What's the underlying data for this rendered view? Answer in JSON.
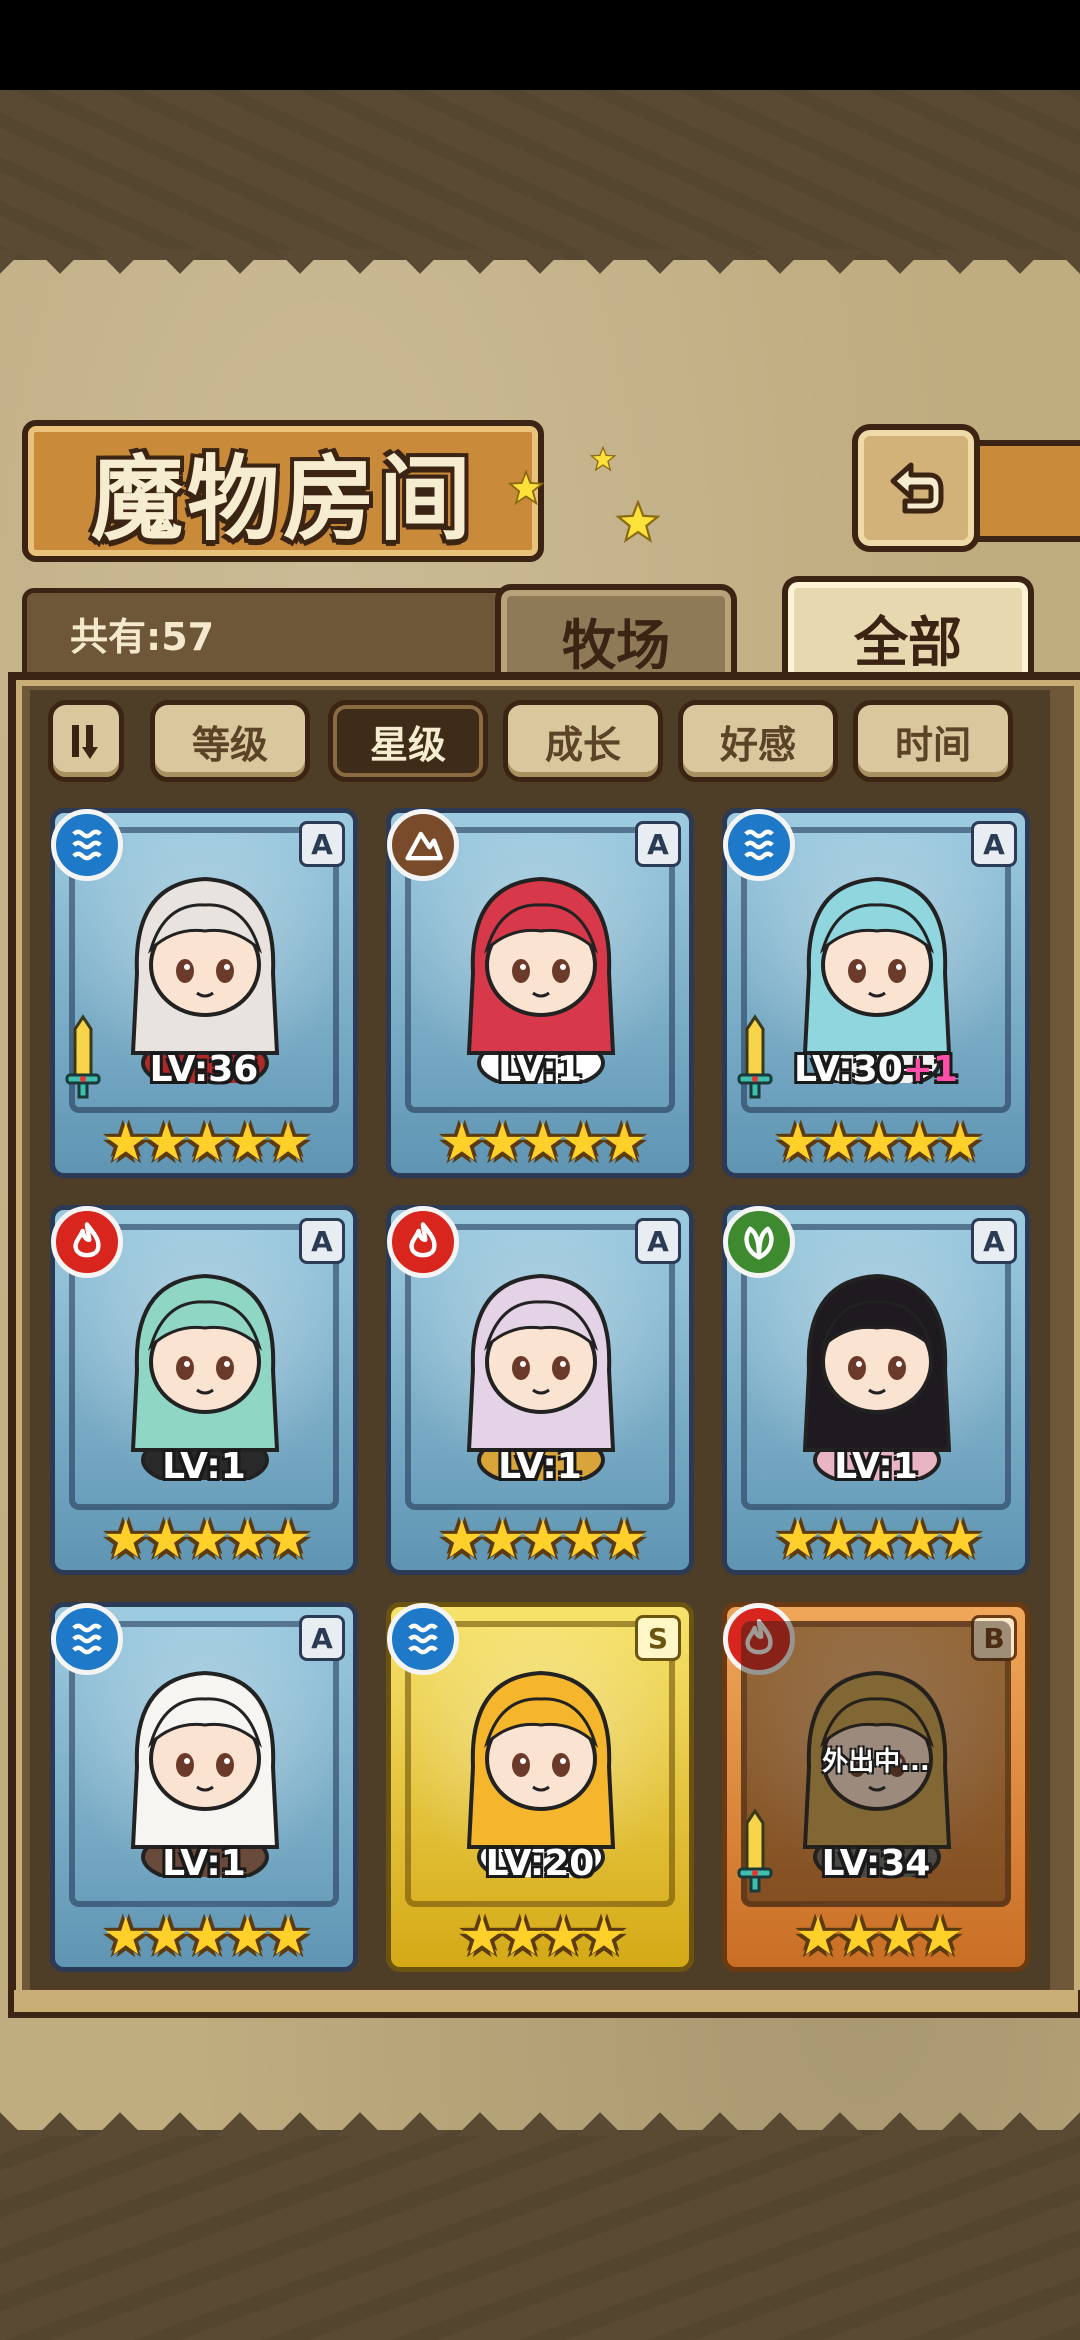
{
  "title": "魔物房间",
  "count_label": "共有:57",
  "tabs": [
    {
      "label": "牧场",
      "active": false
    },
    {
      "label": "全部",
      "active": true
    }
  ],
  "filters": [
    "等级",
    "星级",
    "成长",
    "好感",
    "时间"
  ],
  "selected_filter": "星级",
  "icons": {
    "back": "back-arrow-icon",
    "sort": "sort-toggle-icon",
    "equipment": "sword-icon",
    "elements": {
      "water": "water-element-icon",
      "earth": "earth-element-icon",
      "fire": "fire-element-icon",
      "wood": "leaf-element-icon"
    }
  },
  "colors": {
    "water": "#1f79c9",
    "earth": "#7a4b2a",
    "fire": "#d8261e",
    "wood": "#3e8a2f",
    "star": "#ffcf2a",
    "bonus": "#ff4fa8"
  },
  "monsters": [
    {
      "element": "water",
      "rank": "A",
      "level": "LV:36",
      "bonus": "",
      "stars": 5,
      "equipped": true,
      "status": "",
      "hair": "#e8e3de",
      "accent": "#b02a2a"
    },
    {
      "element": "earth",
      "rank": "A",
      "level": "LV:1",
      "bonus": "",
      "stars": 5,
      "equipped": false,
      "status": "",
      "hair": "#d8394a",
      "accent": "#ffffff"
    },
    {
      "element": "water",
      "rank": "A",
      "level": "LV:30",
      "bonus": "+1",
      "stars": 5,
      "equipped": true,
      "status": "",
      "hair": "#8fd6df",
      "accent": "#f2f2f2"
    },
    {
      "element": "fire",
      "rank": "A",
      "level": "LV:1",
      "bonus": "",
      "stars": 5,
      "equipped": false,
      "status": "",
      "hair": "#8fd6c4",
      "accent": "#2a2a2a"
    },
    {
      "element": "fire",
      "rank": "A",
      "level": "LV:1",
      "bonus": "",
      "stars": 5,
      "equipped": false,
      "status": "",
      "hair": "#e4d3e6",
      "accent": "#d9a43a"
    },
    {
      "element": "wood",
      "rank": "A",
      "level": "LV:1",
      "bonus": "",
      "stars": 5,
      "equipped": false,
      "status": "",
      "hair": "#1e1a1f",
      "accent": "#e9b4c4"
    },
    {
      "element": "water",
      "rank": "A",
      "level": "LV:1",
      "bonus": "",
      "stars": 5,
      "equipped": false,
      "status": "",
      "hair": "#f7f5f2",
      "accent": "#6a4a3a"
    },
    {
      "element": "water",
      "rank": "S",
      "level": "LV:20",
      "bonus": "",
      "stars": 4,
      "equipped": false,
      "status": "",
      "hair": "#f5b52c",
      "accent": "#ffffff"
    },
    {
      "element": "fire",
      "rank": "B",
      "level": "LV:34",
      "bonus": "",
      "stars": 4,
      "equipped": true,
      "status": "外出中...",
      "hair": "#c9a24e",
      "accent": "#6a6a6a"
    }
  ]
}
